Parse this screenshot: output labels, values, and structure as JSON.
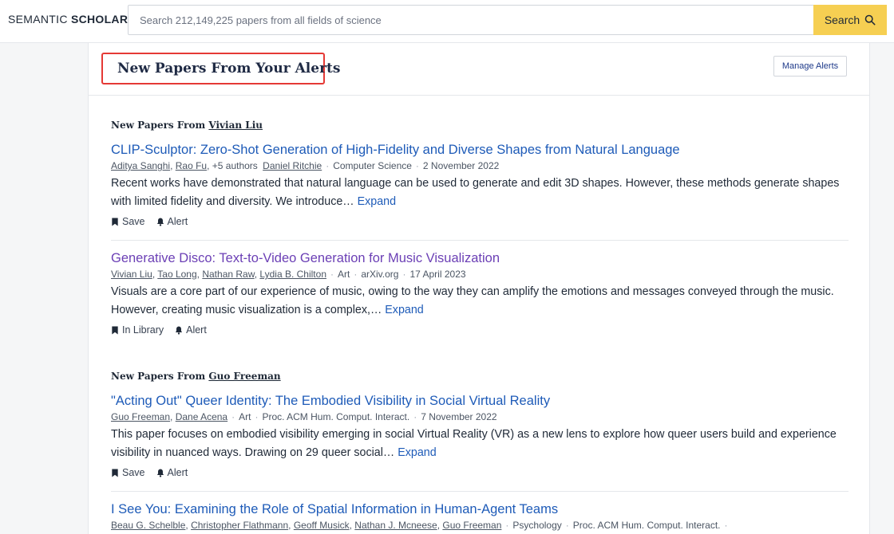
{
  "header": {
    "logo_part1": "SEMANTIC ",
    "logo_part2": "SCHOLAR",
    "search_placeholder": "Search 212,149,225 papers from all fields of science",
    "search_button": "Search"
  },
  "alerts": {
    "title": "New Papers From Your Alerts",
    "manage_button": "Manage Alerts"
  },
  "sections": [
    {
      "prefix": "New Papers From ",
      "author": "Vivian Liu",
      "papers": [
        {
          "title": "CLIP-Sculptor: Zero-Shot Generation of High-Fidelity and Diverse Shapes from Natural Language",
          "authors": [
            "Aditya Sanghi",
            "Rao Fu"
          ],
          "more_authors": "+5 authors",
          "last_author": "Daniel Ritchie",
          "field": "Computer Science",
          "date": "2 November 2022",
          "abstract": "Recent works have demonstrated that natural language can be used to generate and edit 3D shapes. However, these methods generate shapes with limited fidelity and diversity. We introduce… ",
          "expand": "Expand",
          "action1": "Save",
          "action2": "Alert"
        },
        {
          "title": "Generative Disco: Text-to-Video Generation for Music Visualization",
          "authors": [
            "Vivian Liu",
            "Tao Long",
            "Nathan Raw",
            "Lydia B. Chilton"
          ],
          "field": "Art",
          "venue": "arXiv.org",
          "date": "17 April 2023",
          "abstract": "Visuals are a core part of our experience of music, owing to the way they can amplify the emotions and messages conveyed through the music. However, creating music visualization is a complex,… ",
          "expand": "Expand",
          "action1": "In Library",
          "action2": "Alert"
        }
      ]
    },
    {
      "prefix": "New Papers From ",
      "author": "Guo Freeman",
      "papers": [
        {
          "title": "\"Acting Out\" Queer Identity: The Embodied Visibility in Social Virtual Reality",
          "authors": [
            "Guo Freeman",
            "Dane Acena"
          ],
          "field": "Art",
          "venue": "Proc. ACM Hum. Comput. Interact.",
          "date": "7 November 2022",
          "abstract": "This paper focuses on embodied visibility emerging in social Virtual Reality (VR) as a new lens to explore how queer users build and experience visibility in nuanced ways. Drawing on 29 queer social… ",
          "expand": "Expand",
          "action1": "Save",
          "action2": "Alert"
        },
        {
          "title": "I See You: Examining the Role of Spatial Information in Human-Agent Teams",
          "authors": [
            "Beau G. Schelble",
            "Christopher Flathmann",
            "Geoff Musick",
            "Nathan J. Mcneese",
            "Guo Freeman"
          ],
          "field": "Psychology",
          "venue": "Proc. ACM Hum. Comput. Interact."
        }
      ]
    }
  ],
  "colors": {
    "link": "#1e5bb8",
    "visited": "#6b3fb5",
    "search_button": "#f6cf52",
    "highlight_box": "#e53935"
  }
}
